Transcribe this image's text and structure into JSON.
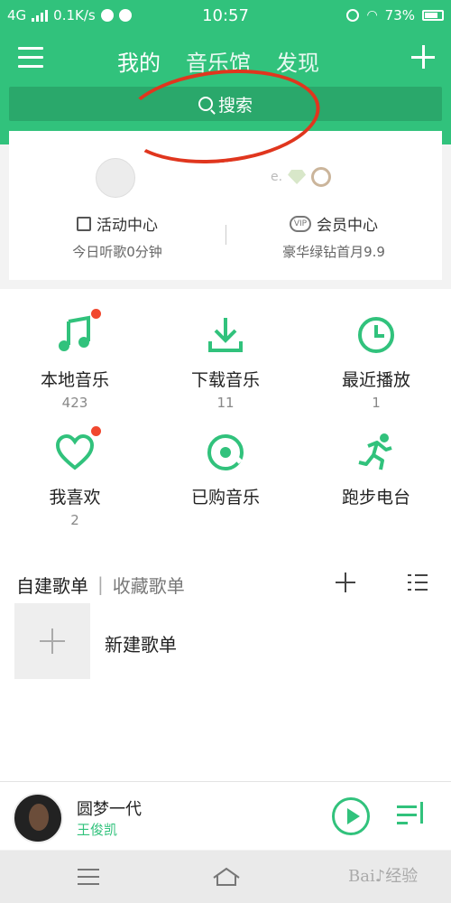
{
  "status_bar": {
    "network": "4G",
    "speed": "0.1K/s",
    "time": "10:57",
    "battery": "73%"
  },
  "nav": {
    "tabs": [
      "我的",
      "音乐馆",
      "发现"
    ]
  },
  "search": {
    "label": "搜索"
  },
  "profile_card": {
    "left_title": "活动中心",
    "left_sub": "今日听歌0分钟",
    "right_title": "会员中心",
    "right_sub": "豪华绿钻首月9.9",
    "right_badge_text": "e."
  },
  "grid": [
    {
      "label": "本地音乐",
      "count": "423",
      "icon": "music-note-icon",
      "dot": true
    },
    {
      "label": "下载音乐",
      "count": "11",
      "icon": "download-icon",
      "dot": false
    },
    {
      "label": "最近播放",
      "count": "1",
      "icon": "clock-icon",
      "dot": false
    },
    {
      "label": "我喜欢",
      "count": "2",
      "icon": "heart-icon",
      "dot": true
    },
    {
      "label": "已购音乐",
      "count": "",
      "icon": "purchased-disc-icon",
      "dot": false
    },
    {
      "label": "跑步电台",
      "count": "",
      "icon": "running-icon",
      "dot": false
    }
  ],
  "playlists": {
    "tab_created": "自建歌单",
    "tab_collected": "收藏歌单",
    "new_playlist": "新建歌单"
  },
  "player": {
    "song": "圆梦一代",
    "artist": "王俊凯"
  },
  "colors": {
    "brand_green": "#31c27c",
    "annotation_red": "#e0361e",
    "badge_red": "#f1482f"
  }
}
